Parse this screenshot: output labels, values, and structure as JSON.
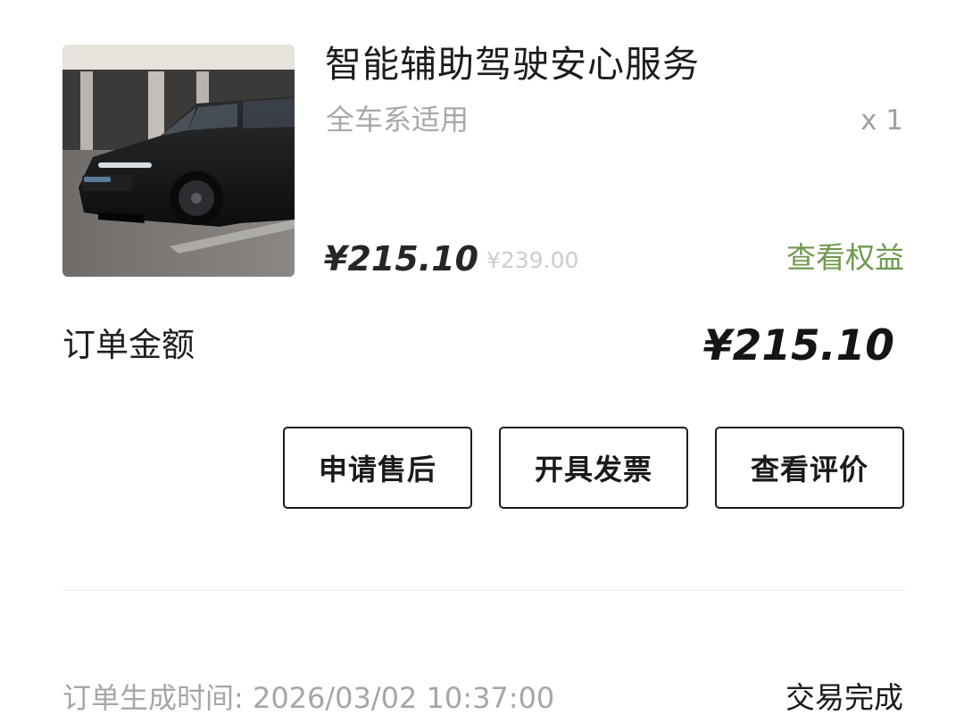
{
  "product": {
    "title": "智能辅助驾驶安心服务",
    "subtitle": "全车系适用",
    "quantity": "x 1",
    "price_current": "¥215.10",
    "price_original": "¥239.00",
    "view_benefits_label": "查看权益"
  },
  "order": {
    "amount_label": "订单金额",
    "amount_value": "¥215.10",
    "created_time_label": "订单生成时间: 2026/03/02 10:37:00",
    "status": "交易完成"
  },
  "actions": {
    "after_sale_label": "申请售后",
    "invoice_label": "开具发票",
    "review_label": "查看评价"
  },
  "colors": {
    "accent_green": "#6e9a4d",
    "button_border": "#1a1a1a",
    "muted_text": "#a8a8a8"
  }
}
